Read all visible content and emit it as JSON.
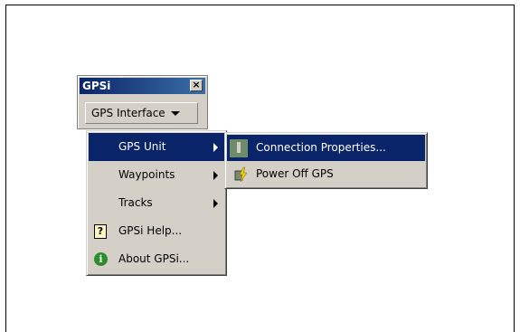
{
  "toolbar": {
    "title": "GPSi",
    "close_glyph": "×",
    "dropdown_label": "GPS Interface"
  },
  "menu": {
    "items": [
      {
        "label": "GPS Unit",
        "submenu": true
      },
      {
        "label": "Waypoints",
        "submenu": true
      },
      {
        "label": "Tracks",
        "submenu": true
      },
      {
        "label": "GPSi Help...",
        "icon": "help-icon"
      },
      {
        "label": "About GPSi...",
        "icon": "info-icon"
      }
    ]
  },
  "submenu": {
    "items": [
      {
        "label": "Connection Properties...",
        "icon": "connection-icon"
      },
      {
        "label": "Power Off GPS",
        "icon": "power-icon"
      }
    ]
  },
  "colors": {
    "highlight": "#0a246a",
    "face": "#d4d0c8"
  }
}
